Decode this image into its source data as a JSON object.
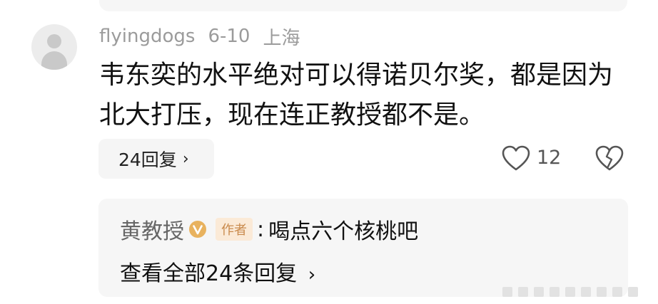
{
  "comment": {
    "username": "flyingdogs",
    "date": "6-10",
    "location": "上海",
    "text": "韦东奕的水平绝对可以得诺贝尔奖，都是因为北大打压，现在连正教授都不是。",
    "reply_count_label": "24回复",
    "chevron": "›",
    "likes": "12",
    "like_icon": "heart-outline-icon",
    "dislike_icon": "broken-heart-icon"
  },
  "reply_preview": {
    "author": "黄教授",
    "verified_icon": "verified-v-icon",
    "author_tag": "作者",
    "separator": ":",
    "text": "喝点六个核桃吧",
    "view_all_label": "查看全部24条回复",
    "chevron": "›"
  },
  "colors": {
    "verified": "#e8b25e",
    "tag_bg": "#fbead7",
    "tag_text": "#c98a4c"
  }
}
